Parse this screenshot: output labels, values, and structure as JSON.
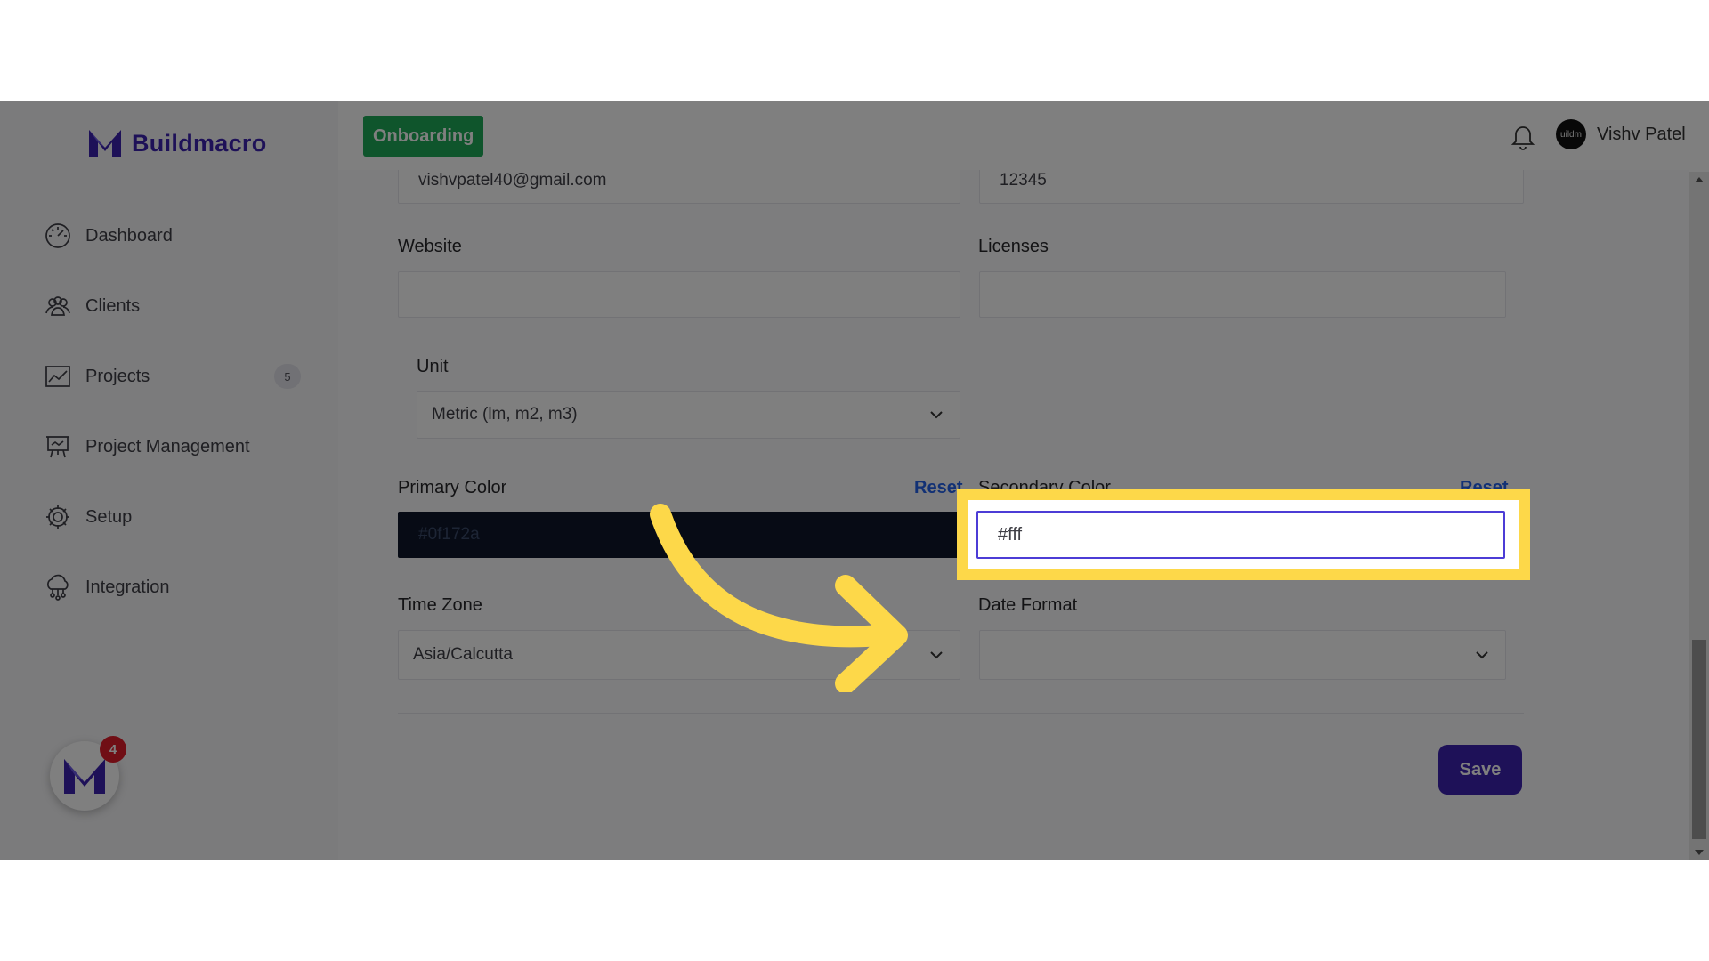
{
  "app": {
    "brand": "Buildmacro",
    "accent": "#3c23b0",
    "onboarding_color": "#1faa59",
    "highlight_color": "#fdd849"
  },
  "sidebar": {
    "items": [
      {
        "label": "Dashboard",
        "icon": "gauge-icon"
      },
      {
        "label": "Clients",
        "icon": "users-icon"
      },
      {
        "label": "Projects",
        "icon": "chart-line-icon",
        "badge": "5"
      },
      {
        "label": "Project Management",
        "icon": "presentation-board-icon"
      },
      {
        "label": "Setup",
        "icon": "gear-icon"
      },
      {
        "label": "Integration",
        "icon": "cloud-network-icon"
      }
    ],
    "chat_badge": "4"
  },
  "header": {
    "onboarding_label": "Onboarding",
    "user_name": "Vishv Patel",
    "avatar_text": "uildm"
  },
  "form": {
    "email_value": "vishvpatel40@gmail.com",
    "phone_value": "12345",
    "website_label": "Website",
    "website_value": "",
    "licenses_label": "Licenses",
    "licenses_value": "",
    "unit_label": "Unit",
    "unit_value": "Metric (lm, m2, m3)",
    "primary_color_label": "Primary Color",
    "primary_color_value": "#0f172a",
    "reset_label": "Reset",
    "secondary_color_label": "Secondary Color",
    "secondary_color_value": "#fff",
    "timezone_label": "Time Zone",
    "timezone_value": "Asia/Calcutta",
    "date_format_label": "Date Format",
    "date_format_value": "",
    "save_label": "Save"
  }
}
